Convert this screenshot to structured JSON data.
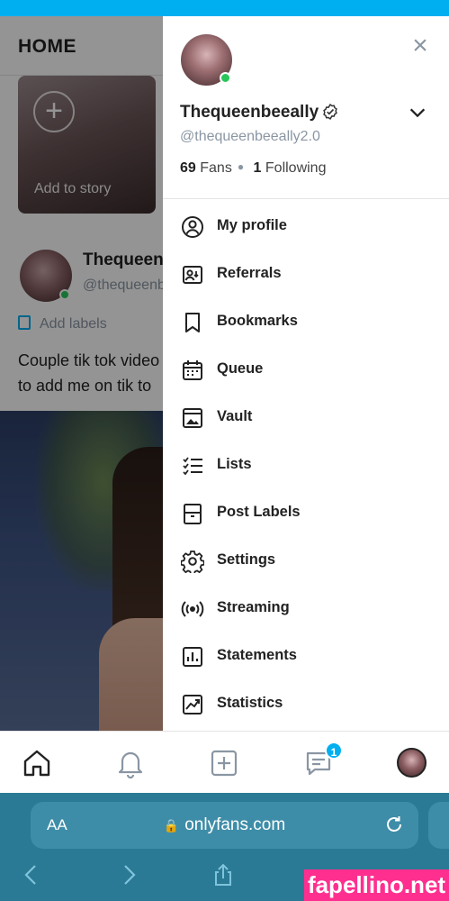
{
  "feed": {
    "title": "HOME",
    "story_label": "Add to story",
    "post_name": "Thequeenb",
    "post_handle": "@thequeenb",
    "add_labels": "Add labels",
    "post_text_line1": "Couple tik tok video",
    "post_text_line2": "to add me on tik to"
  },
  "drawer": {
    "name": "Thequeenbeeally",
    "handle": "@thequeenbeeally2.0",
    "fans_count": "69",
    "fans_label": "Fans",
    "following_count": "1",
    "following_label": "Following",
    "menu": [
      {
        "label": "My profile",
        "icon": "user-circle-icon"
      },
      {
        "label": "Referrals",
        "icon": "referral-icon"
      },
      {
        "label": "Bookmarks",
        "icon": "bookmark-icon"
      },
      {
        "label": "Queue",
        "icon": "calendar-icon"
      },
      {
        "label": "Vault",
        "icon": "vault-image-icon"
      },
      {
        "label": "Lists",
        "icon": "list-icon"
      },
      {
        "label": "Post Labels",
        "icon": "post-label-icon"
      },
      {
        "label": "Settings",
        "icon": "gear-icon"
      },
      {
        "label": "Streaming",
        "icon": "broadcast-icon"
      },
      {
        "label": "Statements",
        "icon": "statement-chart-icon"
      },
      {
        "label": "Statistics",
        "icon": "statistics-chart-icon"
      }
    ]
  },
  "bottom_nav": {
    "messages_badge": "1"
  },
  "browser": {
    "text_size_label": "AA",
    "url": "onlyfans.com"
  },
  "watermark": "fapellino.net",
  "colors": {
    "accent": "#00aff0",
    "online": "#28c65a",
    "text_muted": "#8a96a3",
    "browser_bar": "#2a7a95"
  }
}
